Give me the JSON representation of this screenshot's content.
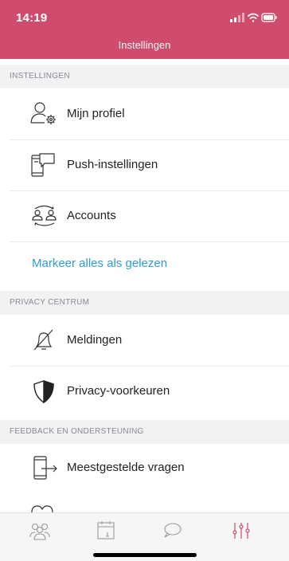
{
  "status_bar": {
    "time": "14:19"
  },
  "header": {
    "title": "Instellingen"
  },
  "sections": {
    "settings": {
      "label": "INSTELLINGEN",
      "items": [
        {
          "label": "Mijn profiel",
          "icon": "profile-settings-icon"
        },
        {
          "label": "Push-instellingen",
          "icon": "push-notification-icon"
        },
        {
          "label": "Accounts",
          "icon": "accounts-switch-icon"
        }
      ],
      "link": "Markeer alles als gelezen"
    },
    "privacy": {
      "label": "PRIVACY CENTRUM",
      "items": [
        {
          "label": "Meldingen",
          "icon": "bell-off-icon"
        },
        {
          "label": "Privacy-voorkeuren",
          "icon": "shield-icon"
        }
      ]
    },
    "feedback": {
      "label": "FEEDBACK EN ONDERSTEUNING",
      "items": [
        {
          "label": "Meestgestelde vragen",
          "icon": "faq-phone-icon"
        }
      ]
    }
  },
  "tabbar": {
    "tabs": [
      {
        "icon": "community-icon",
        "active": false
      },
      {
        "icon": "calendar-icon",
        "active": false
      },
      {
        "icon": "chat-bubble-icon",
        "active": false
      },
      {
        "icon": "settings-sliders-icon",
        "active": true
      }
    ]
  },
  "colors": {
    "accent": "#cf4c6c",
    "link": "#2e9bd6",
    "section_bg": "#f2f2f4"
  }
}
